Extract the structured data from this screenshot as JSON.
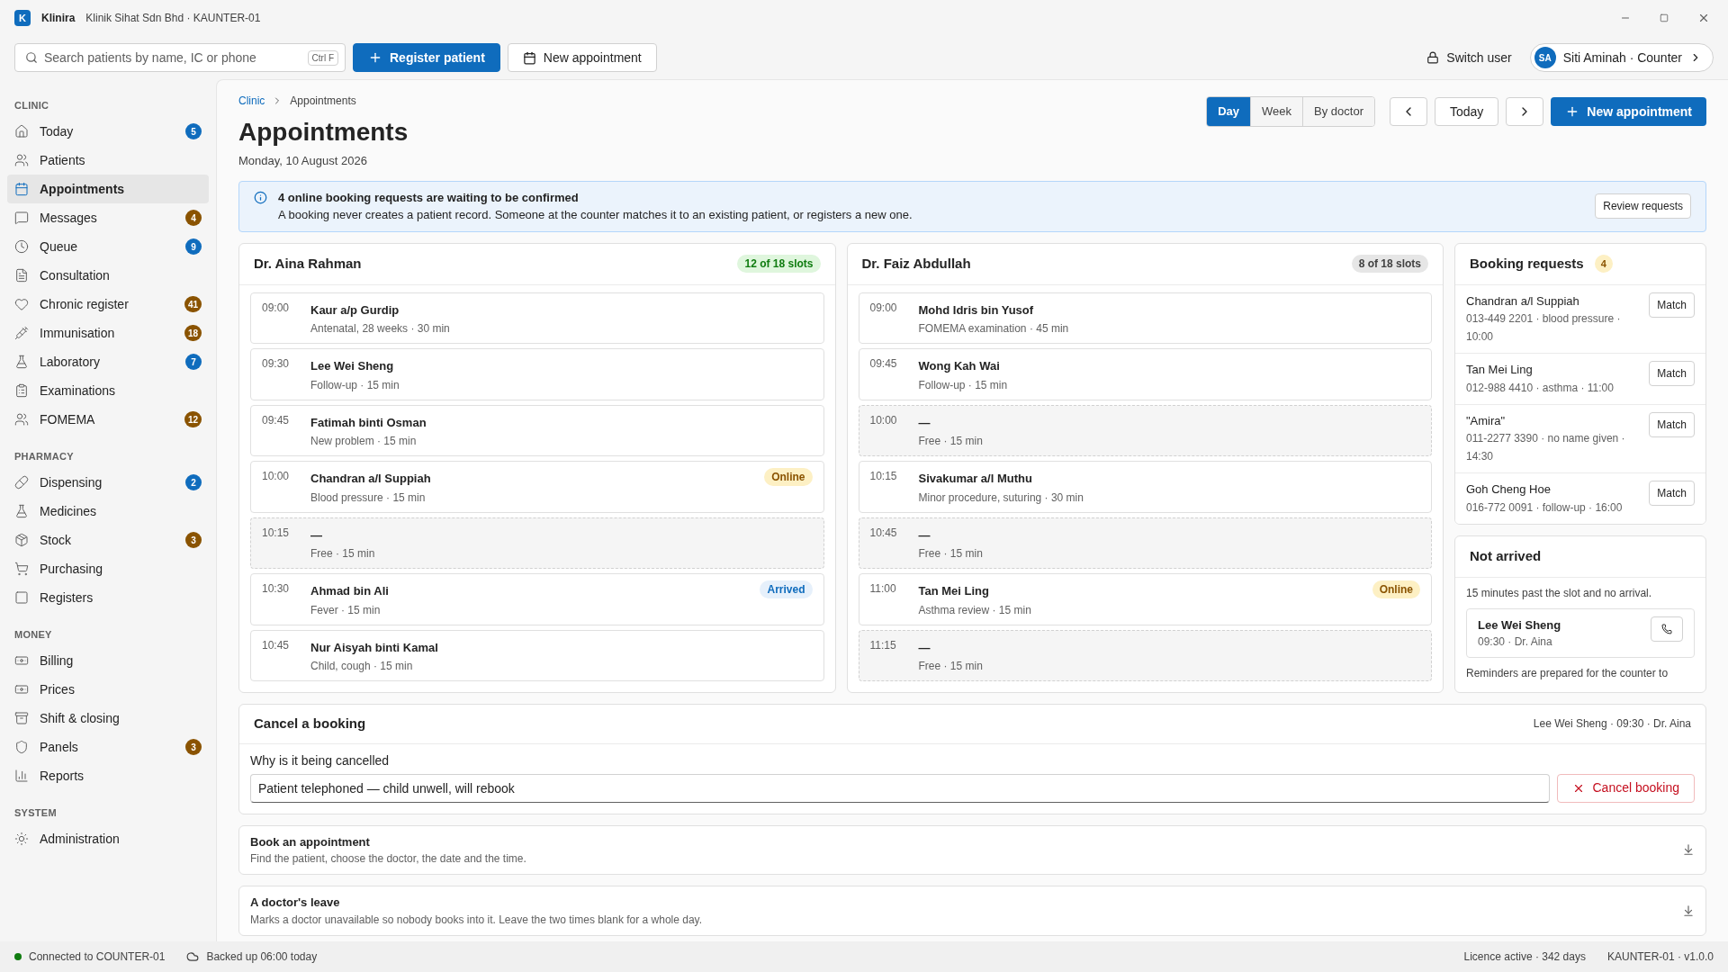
{
  "window": {
    "logo": "K",
    "app_name": "Klinira",
    "subtitle": "Klinik Sihat Sdn Bhd · KAUNTER-01"
  },
  "toolbar": {
    "search": {
      "placeholder": "Search patients by name, IC or phone",
      "shortcut": "Ctrl F"
    },
    "buttons": [
      {
        "label": "Register patient",
        "kind": "primary"
      },
      {
        "label": "New appointment",
        "kind": "secondary"
      }
    ],
    "switch_user": "Switch user",
    "user": {
      "initials": "SA",
      "label": "Siti Aminah · Counter"
    }
  },
  "sidebar": {
    "sections": [
      {
        "title": "CLINIC",
        "items": [
          {
            "label": "Today",
            "selected": false,
            "badge": {
              "text": "5",
              "color": "#0f6cbd"
            }
          },
          {
            "label": "Patients",
            "selected": false
          },
          {
            "label": "Appointments",
            "selected": true
          },
          {
            "label": "Messages",
            "selected": false,
            "badge": {
              "text": "4",
              "color": "#8a5300"
            }
          },
          {
            "label": "Queue",
            "selected": false,
            "badge": {
              "text": "9",
              "color": "#0f6cbd"
            }
          },
          {
            "label": "Consultation",
            "selected": false
          },
          {
            "label": "Chronic register",
            "selected": false,
            "badge": {
              "text": "41",
              "color": "#8a5300"
            }
          },
          {
            "label": "Immunisation",
            "selected": false,
            "badge": {
              "text": "18",
              "color": "#8a5300"
            }
          },
          {
            "label": "Laboratory",
            "selected": false,
            "badge": {
              "text": "7",
              "color": "#0f6cbd"
            }
          },
          {
            "label": "Examinations",
            "selected": false
          },
          {
            "label": "FOMEMA",
            "selected": false,
            "badge": {
              "text": "12",
              "color": "#8a5300"
            }
          }
        ]
      },
      {
        "title": "PHARMACY",
        "items": [
          {
            "label": "Dispensing",
            "selected": false,
            "badge": {
              "text": "2",
              "color": "#0f6cbd"
            }
          },
          {
            "label": "Medicines",
            "selected": false
          },
          {
            "label": "Stock",
            "selected": false,
            "badge": {
              "text": "3",
              "color": "#8a5300"
            }
          },
          {
            "label": "Purchasing",
            "selected": false
          },
          {
            "label": "Registers",
            "selected": false
          }
        ]
      },
      {
        "title": "MONEY",
        "items": [
          {
            "label": "Billing",
            "selected": false
          },
          {
            "label": "Prices",
            "selected": false
          },
          {
            "label": "Shift & closing",
            "selected": false
          },
          {
            "label": "Panels",
            "selected": false,
            "badge": {
              "text": "3",
              "color": "#8a5300"
            }
          },
          {
            "label": "Reports",
            "selected": false
          }
        ]
      },
      {
        "title": "SYSTEM",
        "items": [
          {
            "label": "Administration",
            "selected": false
          }
        ]
      }
    ]
  },
  "page": {
    "breadcrumb": [
      {
        "label": "Clinic",
        "kind": "link"
      },
      {
        "label": "Appointments",
        "kind": "current"
      }
    ],
    "title": "Appointments",
    "date": "Monday, 10 August 2026",
    "view_tabs": [
      {
        "label": "Day",
        "selected": true
      },
      {
        "label": "Week",
        "selected": false
      },
      {
        "label": "By doctor",
        "selected": false
      }
    ],
    "today_button": "Today",
    "new_button": "New appointment"
  },
  "banner": {
    "title": "4 online booking requests are waiting to be confirmed",
    "text": "A booking never creates a patient record. Someone at the counter matches it to an existing patient, or registers a new one.",
    "button": "Review requests"
  },
  "doctors": [
    {
      "name": "Dr. Aina Rahman",
      "slots_badge": {
        "text": "12 of 18 slots",
        "kind": "good"
      },
      "slots": [
        {
          "time": "09:00",
          "kind": "booked",
          "name": "Kaur a/p Gurdip",
          "detail": "Antenatal, 28 weeks · 30 min"
        },
        {
          "time": "09:30",
          "kind": "booked",
          "name": "Lee Wei Sheng",
          "detail": "Follow-up · 15 min"
        },
        {
          "time": "09:45",
          "kind": "booked",
          "name": "Fatimah binti Osman",
          "detail": "New problem · 15 min"
        },
        {
          "time": "10:00",
          "kind": "booked",
          "name": "Chandran a/l Suppiah",
          "detail": "Blood pressure · 15 min",
          "tag": {
            "text": "Online",
            "kind": "online"
          }
        },
        {
          "time": "10:15",
          "kind": "free",
          "name": "—",
          "detail": "Free · 15 min"
        },
        {
          "time": "10:30",
          "kind": "booked",
          "name": "Ahmad bin Ali",
          "detail": "Fever · 15 min",
          "tag": {
            "text": "Arrived",
            "kind": "arrived"
          }
        },
        {
          "time": "10:45",
          "kind": "booked",
          "name": "Nur Aisyah binti Kamal",
          "detail": "Child, cough · 15 min"
        }
      ]
    },
    {
      "name": "Dr. Faiz Abdullah",
      "slots_badge": {
        "text": "8 of 18 slots",
        "kind": "neutral"
      },
      "slots": [
        {
          "time": "09:00",
          "kind": "booked",
          "name": "Mohd Idris bin Yusof",
          "detail": "FOMEMA examination · 45 min"
        },
        {
          "time": "09:45",
          "kind": "booked",
          "name": "Wong Kah Wai",
          "detail": "Follow-up · 15 min"
        },
        {
          "time": "10:00",
          "kind": "free",
          "name": "—",
          "detail": "Free · 15 min"
        },
        {
          "time": "10:15",
          "kind": "booked",
          "name": "Sivakumar a/l Muthu",
          "detail": "Minor procedure, suturing · 30 min"
        },
        {
          "time": "10:45",
          "kind": "free",
          "name": "—",
          "detail": "Free · 15 min"
        },
        {
          "time": "11:00",
          "kind": "booked",
          "name": "Tan Mei Ling",
          "detail": "Asthma review · 15 min",
          "tag": {
            "text": "Online",
            "kind": "online"
          }
        },
        {
          "time": "11:15",
          "kind": "free",
          "name": "—",
          "detail": "Free · 15 min"
        }
      ]
    }
  ],
  "booking_requests": {
    "title": "Booking requests",
    "count": "4",
    "items": [
      {
        "name": "Chandran a/l Suppiah",
        "detail": "013-449 2201 · blood pressure · 10:00",
        "button": "Match"
      },
      {
        "name": "Tan Mei Ling",
        "detail": "012-988 4410 · asthma · 11:00",
        "button": "Match"
      },
      {
        "name": "\"Amira\"",
        "detail": "011-2277 3390 · no name given · 14:30",
        "button": "Match"
      },
      {
        "name": "Goh Cheng Hoe",
        "detail": "016-772 0091 · follow-up · 16:00",
        "button": "Match"
      }
    ]
  },
  "not_arrived": {
    "title": "Not arrived",
    "note": "15 minutes past the slot and no arrival.",
    "items": [
      {
        "name": "Lee Wei Sheng",
        "detail": "09:30 · Dr. Aina"
      }
    ],
    "footer": "Reminders are prepared for the counter to"
  },
  "cancel": {
    "title": "Cancel a booking",
    "context": "Lee Wei Sheng · 09:30 · Dr. Aina",
    "field_label": "Why is it being cancelled",
    "value": "Patient telephoned — child unwell, will rebook",
    "button": "Cancel booking"
  },
  "sections": [
    {
      "title": "Book an appointment",
      "text": "Find the patient, choose the doctor, the date and the time."
    },
    {
      "title": "A doctor's leave",
      "text": "Marks a doctor unavailable so nobody books into it. Leave the two times blank for a whole day."
    }
  ],
  "status_bar": {
    "connection": {
      "text": "Connected to COUNTER-01",
      "connected": true
    },
    "backup": "Backed up 06:00 today",
    "licence": "Licence active · 342 days",
    "version": "KAUNTER-01 · v1.0.0"
  }
}
